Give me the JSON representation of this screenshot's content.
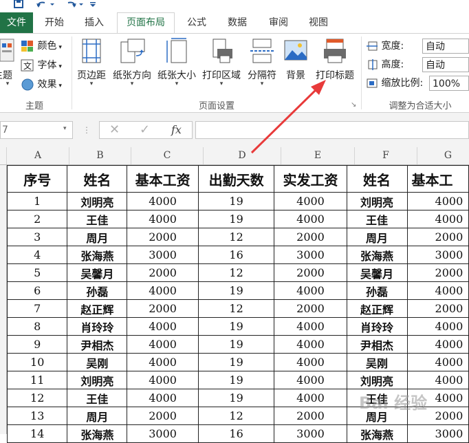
{
  "ribbon_tabs": [
    "文件",
    "开始",
    "插入",
    "页面布局",
    "公式",
    "数据",
    "审阅",
    "视图"
  ],
  "active_tab": "页面布局",
  "theme_group": {
    "theme_label": "主题",
    "colors_label": "颜色",
    "fonts_label": "字体",
    "effects_label": "效果",
    "group_label": "主题"
  },
  "page_setup_group": {
    "buttons": [
      "页边距",
      "纸张方向",
      "纸张大小",
      "打印区域",
      "分隔符",
      "背景",
      "打印标题"
    ],
    "group_label": "页面设置",
    "launcher_glyph": "↘"
  },
  "scale_group": {
    "width_label": "宽度:",
    "width_value": "自动",
    "height_label": "高度:",
    "height_value": "自动",
    "scale_label": "缩放比例:",
    "scale_value": "100%",
    "group_label": "调整为合适大小"
  },
  "formula_bar": {
    "name_box": "7",
    "fx": "fx"
  },
  "columns": [
    "A",
    "B",
    "C",
    "D",
    "E",
    "F",
    "G"
  ],
  "table": {
    "headers": [
      "序号",
      "姓名",
      "基本工资",
      "出勤天数",
      "实发工资",
      "姓名",
      "基本工"
    ],
    "rows": [
      [
        "1",
        "刘明亮",
        "4000",
        "19",
        "4000",
        "刘明亮",
        "4000"
      ],
      [
        "2",
        "王佳",
        "4000",
        "19",
        "4000",
        "王佳",
        "4000"
      ],
      [
        "3",
        "周月",
        "2000",
        "12",
        "2000",
        "周月",
        "2000"
      ],
      [
        "4",
        "张海燕",
        "3000",
        "16",
        "3000",
        "张海燕",
        "3000"
      ],
      [
        "5",
        "吴馨月",
        "2000",
        "12",
        "2000",
        "吴馨月",
        "2000"
      ],
      [
        "6",
        "孙磊",
        "4000",
        "19",
        "4000",
        "孙磊",
        "4000"
      ],
      [
        "7",
        "赵正辉",
        "2000",
        "12",
        "2000",
        "赵正辉",
        "2000"
      ],
      [
        "8",
        "肖玲玲",
        "4000",
        "19",
        "4000",
        "肖玲玲",
        "4000"
      ],
      [
        "9",
        "尹相杰",
        "4000",
        "19",
        "4000",
        "尹相杰",
        "4000"
      ],
      [
        "10",
        "吴刚",
        "4000",
        "19",
        "4000",
        "吴刚",
        "4000"
      ],
      [
        "11",
        "刘明亮",
        "4000",
        "19",
        "4000",
        "刘明亮",
        "4000"
      ],
      [
        "12",
        "王佳",
        "4000",
        "19",
        "4000",
        "王佳",
        "4000"
      ],
      [
        "13",
        "周月",
        "2000",
        "12",
        "2000",
        "周月",
        "2000"
      ],
      [
        "14",
        "张海燕",
        "3000",
        "16",
        "3000",
        "张海燕",
        "3000"
      ]
    ]
  },
  "watermark_text": "Bai 经验",
  "colors": {
    "excel_green": "#217346",
    "arrow_red": "#e83a3a",
    "qa_blue": "#21579b"
  }
}
